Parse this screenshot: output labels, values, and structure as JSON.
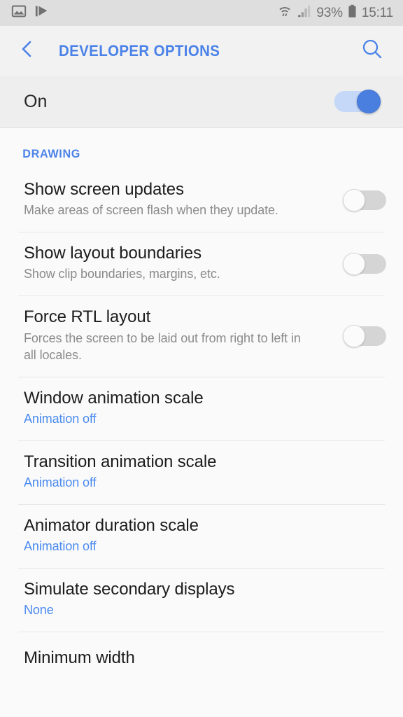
{
  "status_bar": {
    "icons_left": [
      "image-icon",
      "media-play-icon"
    ],
    "wifi_icon": "wifi-icon",
    "signal_icon": "signal-bars-icon",
    "battery_percent": "93%",
    "battery_icon": "battery-icon",
    "time": "15:11"
  },
  "header": {
    "back_icon": "chevron-left-icon",
    "title": "DEVELOPER OPTIONS",
    "search_icon": "search-icon",
    "accent_color": "#4a82e8"
  },
  "master_switch": {
    "label": "On",
    "state": "on"
  },
  "sections": [
    {
      "header": "DRAWING",
      "items": [
        {
          "title": "Show screen updates",
          "subtitle": "Make areas of screen flash when they update.",
          "control": "toggle",
          "state": "off"
        },
        {
          "title": "Show layout boundaries",
          "subtitle": "Show clip boundaries, margins, etc.",
          "control": "toggle",
          "state": "off"
        },
        {
          "title": "Force RTL layout",
          "subtitle": "Forces the screen to be laid out from right to left in all locales.",
          "control": "toggle",
          "state": "off"
        },
        {
          "title": "Window animation scale",
          "subtitle": "Animation off",
          "control": "value"
        },
        {
          "title": "Transition animation scale",
          "subtitle": "Animation off",
          "control": "value"
        },
        {
          "title": "Animator duration scale",
          "subtitle": "Animation off",
          "control": "value"
        },
        {
          "title": "Simulate secondary displays",
          "subtitle": "None",
          "control": "value"
        },
        {
          "title": "Minimum width",
          "subtitle": "",
          "control": "value"
        }
      ]
    }
  ],
  "colors": {
    "accent": "#4a82e8",
    "value_text": "#4a8af0",
    "title_text": "#1c1c1c",
    "subtitle_text": "#8b8b8b",
    "status_bar_bg": "#dedede",
    "header_bg": "#f2f2f2",
    "master_row_bg": "#eeeeee",
    "content_bg": "#fafafa",
    "toggle_on": "#4a7fe0",
    "toggle_off_track": "#d5d5d5"
  }
}
